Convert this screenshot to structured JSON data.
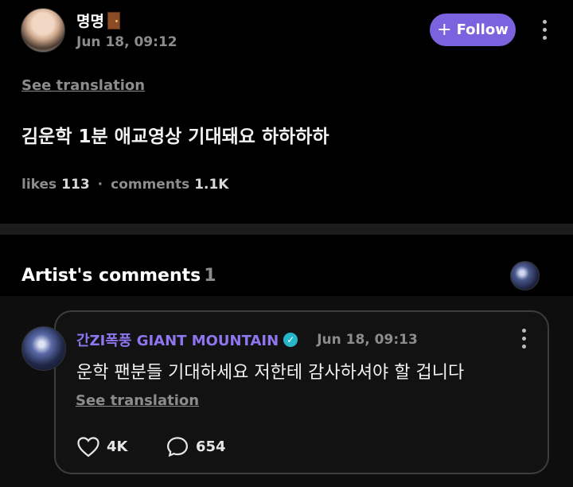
{
  "post": {
    "username": "명명",
    "time": "Jun 18, 09:12",
    "follow_label": "Follow",
    "see_translation": "See translation",
    "text": "김운학 1분 애교영상 기대돼요 하하하하",
    "likes_label": "likes",
    "likes_count": "113",
    "separator": "·",
    "comments_label": "comments",
    "comments_count": "1.1K"
  },
  "artist_comments": {
    "header": "Artist's comments",
    "count": "1"
  },
  "comment": {
    "author": "간ZI폭풍 GIANT MOUNTAIN",
    "time": "Jun 18, 09:13",
    "text": "운학 팬분들 기대하세요 저한테 감사하셔야 할 겁니다",
    "see_translation": "See translation",
    "likes": "4K",
    "replies": "654"
  },
  "colors": {
    "accent": "#7b63e0",
    "verified": "#27b6c9",
    "author_name": "#8e76f0"
  },
  "icons": [
    "door-emoji-icon",
    "plus-icon",
    "more-icon",
    "verified-icon",
    "heart-icon",
    "comment-bubble-icon"
  ]
}
